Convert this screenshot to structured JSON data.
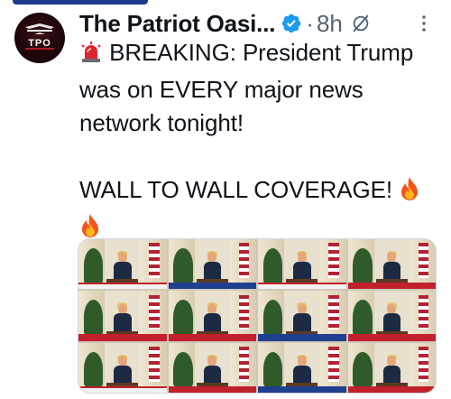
{
  "post": {
    "display_name": "The Patriot Oasi...",
    "separator": "·",
    "timestamp": "8h",
    "text_lines": {
      "line1": "BREAKING: President Trump",
      "line2": "was on EVERY major news",
      "line3": "network tonight!",
      "line4": "WALL TO WALL COVERAGE!"
    }
  },
  "avatar": {
    "letters": "TPO"
  },
  "icons": {
    "verified": "verified-badge-icon",
    "grok": "grok-icon",
    "more": "more-options-icon",
    "siren": "police-siren-emoji",
    "fire": "fire-emoji"
  },
  "colors": {
    "verified_blue": "#1d9bf0",
    "secondary_text": "#536471",
    "primary_text": "#0f1419",
    "avatar_red": "#d2232a"
  }
}
